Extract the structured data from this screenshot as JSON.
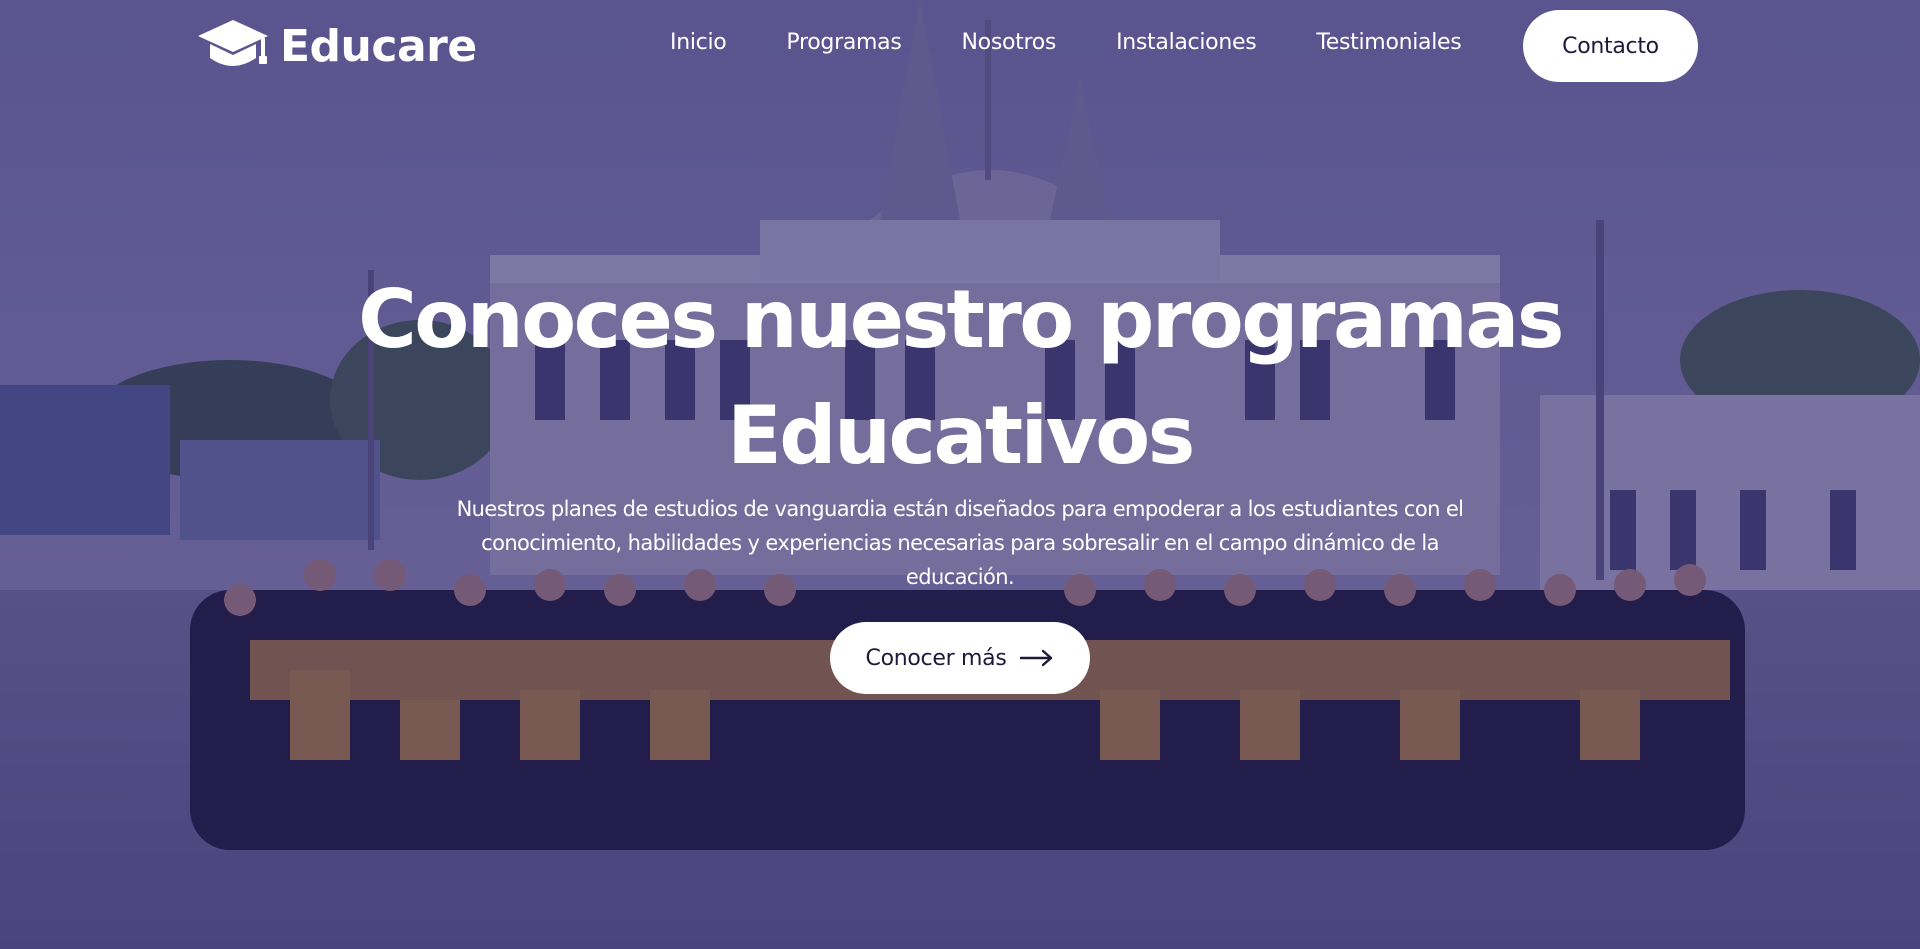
{
  "brand": {
    "name": "Educare",
    "icon": "graduation-cap-icon"
  },
  "nav": {
    "items": [
      {
        "label": "Inicio"
      },
      {
        "label": "Programas"
      },
      {
        "label": "Nosotros"
      },
      {
        "label": "Instalaciones"
      },
      {
        "label": "Testimoniales"
      }
    ],
    "contact_label": "Contacto"
  },
  "hero": {
    "title_line1": "Conoces nuestro programas",
    "title_line2": "Educativos",
    "description": "Nuestros planes de estudios de vanguardia están diseñados para empoderar a los estudiantes con el conocimiento, habilidades y experiencias necesarias para sobresalir en el campo dinámico de la educación.",
    "cta_label": "Conocer más",
    "cta_icon": "arrow-right-icon"
  },
  "colors": {
    "overlay": "#30266e",
    "button_bg": "#ffffff",
    "button_text": "#1d1b3a",
    "gown_accent": "#e0a030"
  }
}
